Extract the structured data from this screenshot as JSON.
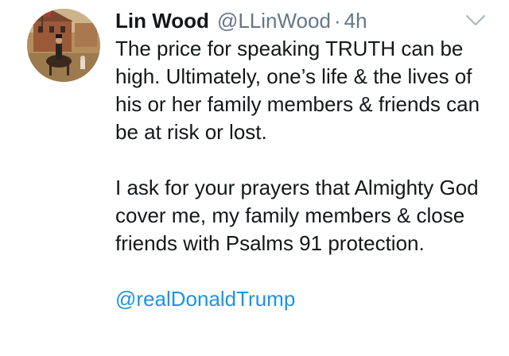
{
  "tweet": {
    "author_name": "Lin Wood",
    "handle": "@LLinWood",
    "separator": "·",
    "timestamp": "4h",
    "paragraphs": [
      "The price for speaking TRUTH can be high. Ultimately, one’s life & the lives of his or her family members & friends can be at risk or lost.",
      "I ask for your prayers that Almighty God cover me, my family members & close friends with Psalms 91 protection."
    ],
    "mention": "@realDonaldTrump"
  },
  "icons": {
    "avatar": "avatar-painting-horseman",
    "menu": "chevron-down-icon"
  },
  "colors": {
    "text": "#14171a",
    "secondary": "#657786",
    "link": "#1b95e0",
    "caret": "#aab8c2"
  }
}
